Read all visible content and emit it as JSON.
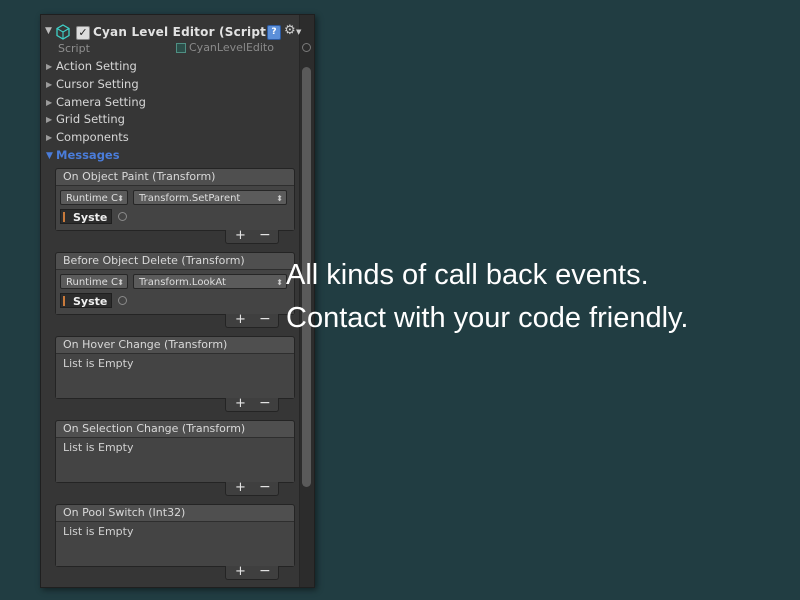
{
  "component": {
    "title": "Cyan Level Editor (Script)",
    "script_label": "Script",
    "script_value": "CyanLevelEdito",
    "enabled_check": "✓",
    "help_icon": "?",
    "gear_icon": "⚙"
  },
  "foldouts": [
    {
      "label": "Action Setting",
      "expanded": false
    },
    {
      "label": "Cursor Setting",
      "expanded": false
    },
    {
      "label": "Camera Setting",
      "expanded": false
    },
    {
      "label": "Grid Setting",
      "expanded": false
    },
    {
      "label": "Components",
      "expanded": false
    },
    {
      "label": "Messages",
      "expanded": true
    }
  ],
  "events": [
    {
      "title": "On Object Paint (Transform)",
      "runtime": "Runtime C",
      "function": "Transform.SetParent",
      "object": "Syste"
    },
    {
      "title": "Before Object Delete (Transform)",
      "runtime": "Runtime C",
      "function": "Transform.LookAt",
      "object": "Syste"
    },
    {
      "title": "On Hover Change (Transform)",
      "empty": "List is Empty"
    },
    {
      "title": "On Selection Change (Transform)",
      "empty": "List is Empty"
    },
    {
      "title": "On Pool Switch (Int32)",
      "empty": "List is Empty"
    }
  ],
  "list_controls": {
    "add": "+",
    "remove": "−"
  },
  "caption": {
    "line1": "All kinds of call back events.",
    "line2": "Contact with your code friendly."
  },
  "colors": {
    "background": "#213d42",
    "panel": "#363636",
    "foldout_active": "#4a7cd9",
    "caption_text": "#ffffff"
  }
}
